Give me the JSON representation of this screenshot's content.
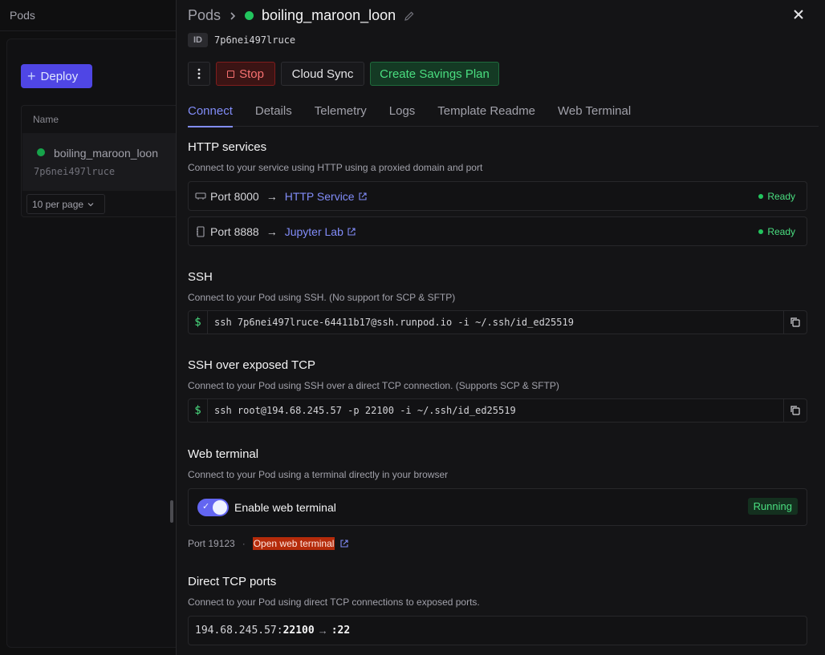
{
  "background": {
    "page_title": "Pods",
    "deploy_label": "Deploy",
    "table_header": "Name",
    "row_name": "boiling_maroon_loon",
    "row_id": "7p6nei497lruce",
    "per_page": "10 per page"
  },
  "drawer": {
    "breadcrumb_root": "Pods",
    "pod_name": "boiling_maroon_loon",
    "id_label": "ID",
    "id_value": "7p6nei497lruce",
    "status_color": "#22c55e",
    "actions": {
      "more_icon": "more-vertical-icon",
      "stop_label": "Stop",
      "sync_label": "Cloud Sync",
      "savings_label": "Create Savings Plan"
    },
    "tabs": [
      {
        "label": "Connect",
        "active": true
      },
      {
        "label": "Details",
        "active": false
      },
      {
        "label": "Telemetry",
        "active": false
      },
      {
        "label": "Logs",
        "active": false
      },
      {
        "label": "Template Readme",
        "active": false
      },
      {
        "label": "Web Terminal",
        "active": false
      }
    ]
  },
  "http": {
    "title": "HTTP services",
    "desc": "Connect to your service using HTTP using a proxied domain and port",
    "services": [
      {
        "port": "Port 8000",
        "link": "HTTP Service",
        "status": "Ready",
        "icon": "server-icon"
      },
      {
        "port": "Port 8888",
        "link": "Jupyter Lab",
        "status": "Ready",
        "icon": "notebook-icon"
      }
    ]
  },
  "ssh": {
    "title": "SSH",
    "desc": "Connect to your Pod using SSH. (No support for SCP & SFTP)",
    "prompt": "$",
    "command": "ssh 7p6nei497lruce-64411b17@ssh.runpod.io -i ~/.ssh/id_ed25519"
  },
  "ssh_tcp": {
    "title": "SSH over exposed TCP",
    "desc": "Connect to your Pod using SSH over a direct TCP connection. (Supports SCP & SFTP)",
    "prompt": "$",
    "command": "ssh root@194.68.245.57 -p 22100 -i ~/.ssh/id_ed25519"
  },
  "web_terminal": {
    "title": "Web terminal",
    "desc": "Connect to your Pod using a terminal directly in your browser",
    "toggle_label": "Enable web terminal",
    "toggle_on": true,
    "status": "Running",
    "port": "Port 19123",
    "separator": "·",
    "open_label": "Open web terminal"
  },
  "direct_tcp": {
    "title": "Direct TCP ports",
    "desc": "Connect to your Pod using direct TCP connections to exposed ports.",
    "host": "194.68.245.57:",
    "external_port": "22100",
    "internal_port": ":22"
  }
}
